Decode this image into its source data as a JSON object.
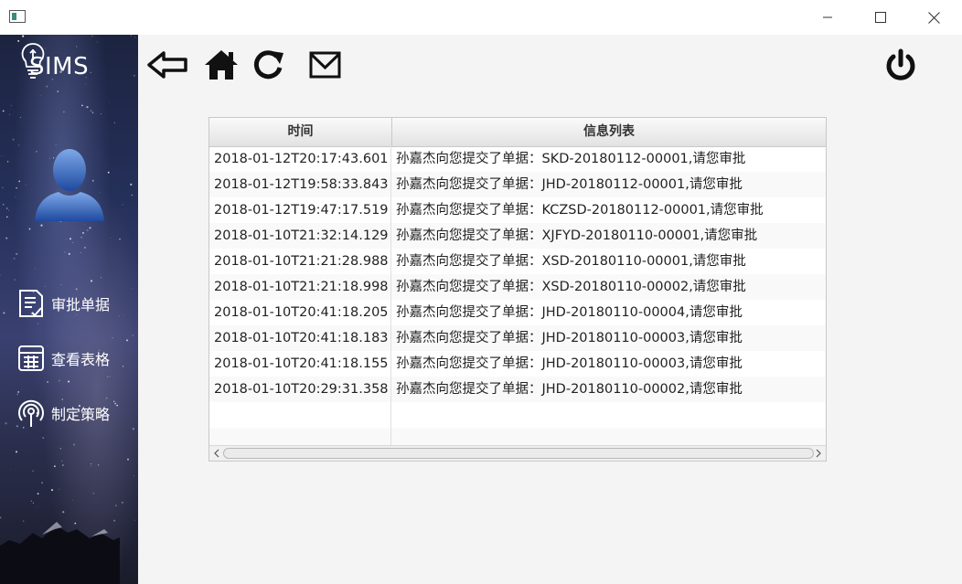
{
  "app": {
    "logo_text": "SIMS"
  },
  "sidebar": {
    "items": [
      {
        "label": "审批单据",
        "icon": "document-approve-icon"
      },
      {
        "label": "查看表格",
        "icon": "table-grid-icon"
      },
      {
        "label": "制定策略",
        "icon": "signal-tower-icon"
      }
    ]
  },
  "toolbar": {
    "back": "back-arrow-icon",
    "home": "home-icon",
    "refresh": "refresh-icon",
    "mail": "mail-icon",
    "power": "power-icon"
  },
  "table": {
    "columns": [
      "时间",
      "信息列表"
    ],
    "rows": [
      {
        "time": "2018-01-12T20:17:43.601",
        "info": "孙嘉杰向您提交了单据：SKD-20180112-00001,请您审批"
      },
      {
        "time": "2018-01-12T19:58:33.843",
        "info": "孙嘉杰向您提交了单据：JHD-20180112-00001,请您审批"
      },
      {
        "time": "2018-01-12T19:47:17.519",
        "info": "孙嘉杰向您提交了单据：KCZSD-20180112-00001,请您审批"
      },
      {
        "time": "2018-01-10T21:32:14.129",
        "info": "孙嘉杰向您提交了单据：XJFYD-20180110-00001,请您审批"
      },
      {
        "time": "2018-01-10T21:21:28.988",
        "info": "孙嘉杰向您提交了单据：XSD-20180110-00001,请您审批"
      },
      {
        "time": "2018-01-10T21:21:18.998",
        "info": "孙嘉杰向您提交了单据：XSD-20180110-00002,请您审批"
      },
      {
        "time": "2018-01-10T20:41:18.205",
        "info": "孙嘉杰向您提交了单据：JHD-20180110-00004,请您审批"
      },
      {
        "time": "2018-01-10T20:41:18.183",
        "info": "孙嘉杰向您提交了单据：JHD-20180110-00003,请您审批"
      },
      {
        "time": "2018-01-10T20:41:18.155",
        "info": "孙嘉杰向您提交了单据：JHD-20180110-00003,请您审批"
      },
      {
        "time": "2018-01-10T20:29:31.358",
        "info": "孙嘉杰向您提交了单据：JHD-20180110-00002,请您审批"
      },
      {
        "time": "",
        "info": ""
      },
      {
        "time": "",
        "info": ""
      }
    ]
  },
  "colors": {
    "sidebar_bg": "#25305a",
    "content_bg": "#f4f4f4",
    "header_bg": "#e2e2e2"
  }
}
